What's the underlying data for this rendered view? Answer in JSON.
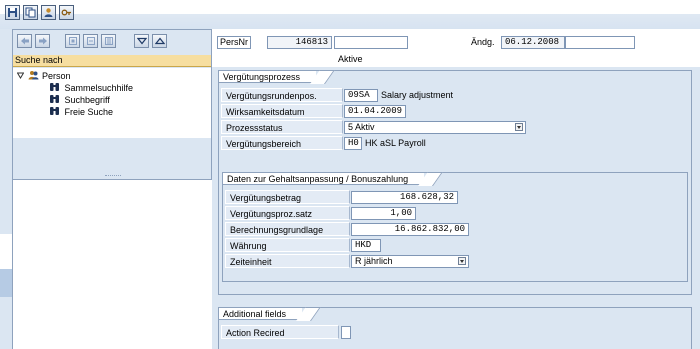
{
  "toolbar": {
    "icons": [
      "save-icon",
      "copy-icon",
      "person-icon",
      "key-icon"
    ]
  },
  "navigator": {
    "buttons": [
      "back-arrow-icon",
      "forward-arrow-icon",
      "nav-button-3-icon",
      "nav-button-4-icon",
      "nav-button-5-icon",
      "expand-icon",
      "collapse-icon"
    ],
    "search_header": "Suche nach",
    "root": "Person",
    "items": [
      "Sammelsuchhilfe",
      "Suchbegriff",
      "Freie Suche"
    ]
  },
  "header": {
    "persnr_label": "PersNr",
    "persnr_value": "146813",
    "name_value": "",
    "status_text": "Aktive",
    "aendg_label": "Ändg.",
    "aendg_value": "06.12.2008",
    "aendg_extra": ""
  },
  "verguetungsprozess": {
    "title": "Vergütungsprozess",
    "rows": [
      {
        "label": "Vergütungsrundenpos.",
        "value": "09SA",
        "desc": "Salary adjustment"
      },
      {
        "label": "Wirksamkeitsdatum",
        "value": "01.04.2009"
      },
      {
        "label": "Prozessstatus",
        "value": "5 Aktiv"
      },
      {
        "label": "Vergütungsbereich",
        "value": "H0",
        "desc": "HK aSL Payroll"
      }
    ]
  },
  "gehalt": {
    "title": "Daten zur Gehaltsanpassung / Bonuszahlung",
    "rows": [
      {
        "label": "Vergütungsbetrag",
        "value": "168.628,32"
      },
      {
        "label": "Vergütungsproz.satz",
        "value": "1,00"
      },
      {
        "label": "Berechnungsgrundlage",
        "value": "16.862.832,00"
      },
      {
        "label": "Währung",
        "value": "HKD"
      },
      {
        "label": "Zeiteinheit",
        "value": "R jährlich"
      }
    ]
  },
  "additional": {
    "title": "Additional fields",
    "rows": [
      {
        "label": "Action Recired",
        "value": ""
      }
    ]
  }
}
